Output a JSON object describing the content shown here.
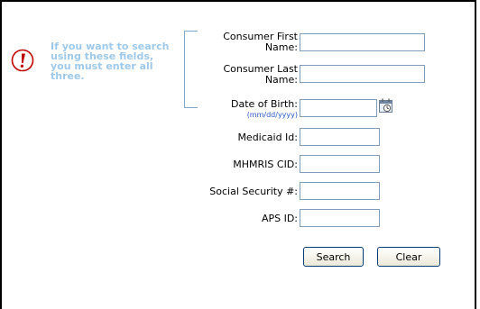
{
  "notice": {
    "text": "If you want to search using these fields, you must enter all three."
  },
  "form": {
    "first_name_label": "Consumer First Name:",
    "first_name_value": "",
    "last_name_label": "Consumer Last Name:",
    "last_name_value": "",
    "dob_label": "Date of Birth:",
    "dob_hint": "(mm/dd/yyyy)",
    "dob_value": "",
    "medicaid_label": "Medicaid Id:",
    "medicaid_value": "",
    "mhmris_label": "MHMRIS CID:",
    "mhmris_value": "",
    "ssn_label": "Social Security #:",
    "ssn_value": "",
    "aps_label": "APS ID:",
    "aps_value": ""
  },
  "buttons": {
    "search_label": "Search",
    "clear_label": "Clear"
  },
  "icons": {
    "warning": "exclamation-warning-icon",
    "calendar": "calendar-icon"
  },
  "colors": {
    "notice_text": "#9ec9ea",
    "warning_red": "#c00000",
    "hint_blue": "#2a58c8"
  }
}
